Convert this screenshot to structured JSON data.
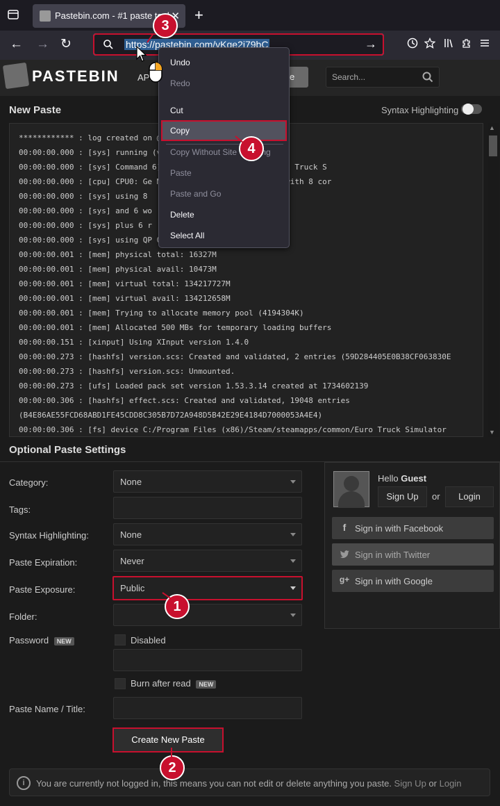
{
  "browser": {
    "tab_title": "Pastebin.com - #1 paste tool",
    "tab_close": "✕",
    "new_tab": "+",
    "back": "←",
    "forward": "→",
    "reload": "↻",
    "url": "https://pastebin.com/yKge2i79bC",
    "go": "→"
  },
  "header": {
    "logo_text": "PASTEBIN",
    "api": "API",
    "paste_button": "aste",
    "search_placeholder": "Search..."
  },
  "new_paste": {
    "title": "New Paste",
    "syntax_toggle_label": "Syntax Highlighting",
    "lines": [
      "************ : log created on                        @ 21:45:36",
      "00:00:00.000 : [sys] running                        (version 10.0.19045)",
      "00:00:00.000 : [sys] Command                        6)\\Steam\\steamapps\\common\\Euro Truck S",
      "00:00:00.000 : [cpu] CPU0: Ge                       M) i5-14600K CPU @ 5.30GHz] with 8 cor",
      "00:00:00.000 : [sys] using 8",
      "00:00:00.000 : [sys] and 6 wo",
      "00:00:00.000 : [sys] plus 6 r",
      "00:00:00.000 : [sys] using QP                       0000000Hz",
      "00:00:00.001 : [mem] physical total: 16327M",
      "00:00:00.001 : [mem] physical avail: 10473M",
      "00:00:00.001 : [mem] virtual total: 134217727M",
      "00:00:00.001 : [mem] virtual avail: 134212658M",
      "00:00:00.001 : [mem] Trying to allocate memory pool (4194304K)",
      "00:00:00.001 : [mem] Allocated 500 MBs for temporary loading buffers",
      "00:00:00.151 : [xinput] Using XInput version 1.4.0",
      "00:00:00.273 : [hashfs] version.scs: Created and validated, 2 entries (59D284405E0B38CF063830E",
      "00:00:00.273 : [hashfs] version.scs: Unmounted.",
      "00:00:00.273 : [ufs] Loaded pack set version 1.53.3.14 created at 1734602139",
      "00:00:00.306 : [hashfs] effect.scs: Created and validated, 19048 entries",
      "(B4E86AE55FCD68ABD1FE45CDD8C305B7D72A948D5B42E29E4184D7000053A4E4)",
      "00:00:00.306 : [fs] device C:/Program Files (x86)/Steam/steamapps/common/Euro Truck Simulator"
    ]
  },
  "settings": {
    "title": "Optional Paste Settings",
    "category_label": "Category:",
    "category_value": "None",
    "tags_label": "Tags:",
    "syntax_label": "Syntax Highlighting:",
    "syntax_value": "None",
    "expiration_label": "Paste Expiration:",
    "expiration_value": "Never",
    "exposure_label": "Paste Exposure:",
    "exposure_value": "Public",
    "folder_label": "Folder:",
    "password_label": "Password",
    "new_badge": "NEW",
    "password_disabled": "Disabled",
    "burn_label": "Burn after read",
    "name_label": "Paste Name / Title:",
    "create_button": "Create New Paste"
  },
  "side": {
    "hello": "Hello",
    "guest": "Guest",
    "signup": "Sign Up",
    "or": "or",
    "login": "Login",
    "facebook": "Sign in with Facebook",
    "twitter": "Sign in with Twitter",
    "google": "Sign in with Google"
  },
  "notice": {
    "icon": "i",
    "text": "You are currently not logged in, this means you can not edit or delete anything you paste.",
    "signup": "Sign Up",
    "or": "or",
    "login": "Login"
  },
  "context_menu": {
    "undo": "Undo",
    "redo": "Redo",
    "cut": "Cut",
    "copy": "Copy",
    "copy_without_site": "Copy Without Site Tracking",
    "paste": "Paste",
    "paste_and_go": "Paste and Go",
    "delete": "Delete",
    "select_all": "Select All"
  },
  "markers": {
    "one": "1",
    "two": "2",
    "three": "3",
    "four": "4"
  },
  "colors": {
    "annotation_red": "#c8102e",
    "url_focus": "#00ddff",
    "background": "#1b1b1b"
  }
}
